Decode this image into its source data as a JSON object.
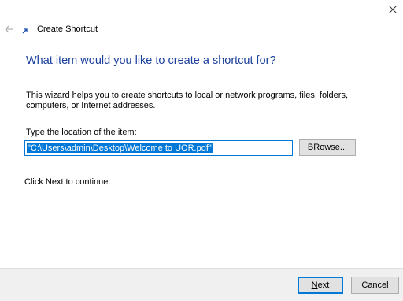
{
  "window": {
    "title": "Create Shortcut",
    "close_icon": "close-icon",
    "back_icon": "back-arrow-icon",
    "wizard_icon": "shortcut-icon"
  },
  "main": {
    "heading": "What item would you like to create a shortcut for?",
    "description": "This wizard helps you to create shortcuts to local or network programs, files, folders, computers, or Internet addresses.",
    "field_label_mnemonic": "T",
    "field_label_rest": "ype the location of the item:",
    "location_value": "\"C:\\Users\\admin\\Desktop\\Welcome to UOR.pdf\"",
    "browse_label_mnemonic": "R",
    "browse_label_rest": "owse...",
    "browse_label_prefix": "B",
    "continue_hint": "Click Next to continue."
  },
  "footer": {
    "next_mnemonic": "N",
    "next_rest": "ext",
    "cancel_label": "Cancel"
  },
  "colors": {
    "accent": "#0078d7",
    "heading": "#1a3f9c",
    "footer_bg": "#f0f0f0"
  }
}
